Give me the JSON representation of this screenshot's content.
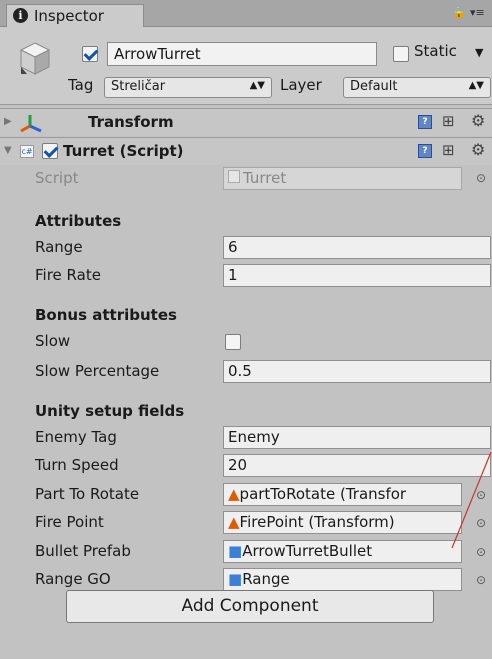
{
  "tab": {
    "title": "Inspector",
    "info_icon": "i"
  },
  "window": {
    "lock_icon": "lock-icon",
    "menu_icon": "menu-icon"
  },
  "gameobject": {
    "active": true,
    "name": "ArrowTurret",
    "static_label": "Static",
    "static_checked": false,
    "tag_label": "Tag",
    "tag_value": "Streličar",
    "layer_label": "Layer",
    "layer_value": "Default"
  },
  "transform": {
    "name": "Transform"
  },
  "turret": {
    "name": "Turret (Script)",
    "enabled": true,
    "script_label": "Script",
    "script_value": "Turret",
    "sections": {
      "attributes": "Attributes",
      "bonus": "Bonus attributes",
      "setup": "Unity setup fields"
    },
    "fields": {
      "range": {
        "label": "Range",
        "value": "6"
      },
      "fire_rate": {
        "label": "Fire Rate",
        "value": "1"
      },
      "slow": {
        "label": "Slow",
        "checked": false
      },
      "slow_percentage": {
        "label": "Slow Percentage",
        "value": "0.5"
      },
      "enemy_tag": {
        "label": "Enemy Tag",
        "value": "Enemy"
      },
      "turn_speed": {
        "label": "Turn Speed",
        "value": "20"
      },
      "part_to_rotate": {
        "label": "Part To Rotate",
        "value": "partToRotate (Transfor"
      },
      "fire_point": {
        "label": "Fire Point",
        "value": "FirePoint (Transform)"
      },
      "bullet_prefab": {
        "label": "Bullet Prefab",
        "value": "ArrowTurretBullet"
      },
      "range_go": {
        "label": "Range GO",
        "value": "Range"
      }
    }
  },
  "add_component": "Add Component",
  "colors": {
    "transform_icon": "#e05a00",
    "prefab_icon": "#3b7fd6",
    "annotation": "#c0392b"
  }
}
